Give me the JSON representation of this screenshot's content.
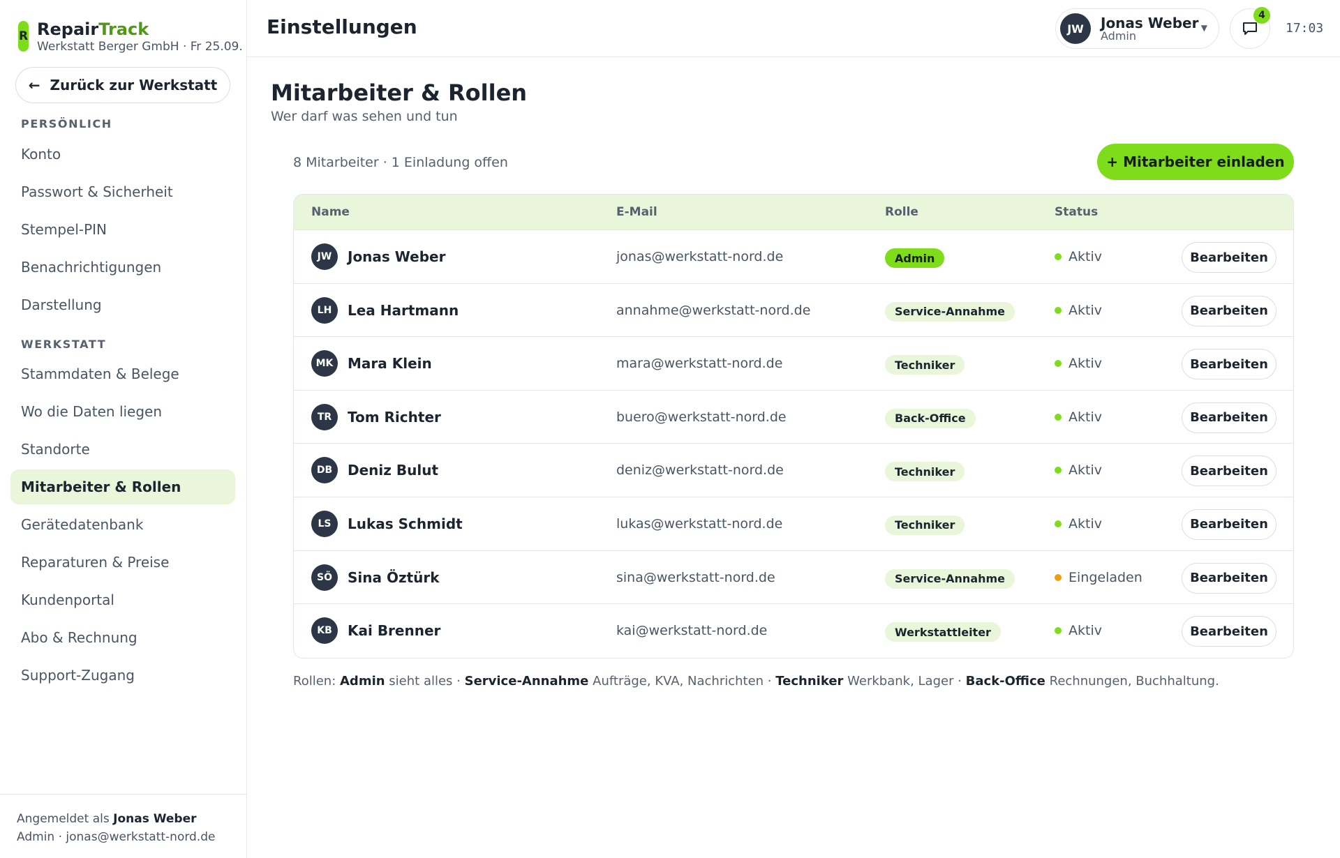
{
  "brand": {
    "logo_letter": "R",
    "name_a": "Repair",
    "name_b": "Track",
    "subtitle": "Werkstatt Berger GmbH · Fr 25.09."
  },
  "sidebar": {
    "back_label": "Zurück zur Werkstatt",
    "section_personal": "PERSÖNLICH",
    "personal_items": [
      "Konto",
      "Passwort & Sicherheit",
      "Stempel-PIN",
      "Benachrichtigungen",
      "Darstellung"
    ],
    "section_workshop": "WERKSTATT",
    "workshop_items": [
      "Stammdaten & Belege",
      "Wo die Daten liegen",
      "Standorte",
      "Mitarbeiter & Rollen",
      "Gerätedatenbank",
      "Reparaturen & Preise",
      "Kundenportal",
      "Abo & Rechnung",
      "Support-Zugang"
    ],
    "active_item": "Mitarbeiter & Rollen",
    "footer_prefix": "Angemeldet als",
    "footer_user": "Jonas Weber",
    "footer_detail": "Admin · jonas@werkstatt-nord.de"
  },
  "header": {
    "title": "Einstellungen",
    "user_initials": "JW",
    "user_name": "Jonas Weber",
    "user_role": "Admin",
    "message_count": "4",
    "time": "17:03"
  },
  "main": {
    "title": "Mitarbeiter & Rollen",
    "subtitle": "Wer darf was sehen und tun",
    "count_text": "8 Mitarbeiter · 1 Einladung offen",
    "invite_label": "+ Mitarbeiter einladen",
    "columns": {
      "name": "Name",
      "email": "E-Mail",
      "role": "Rolle",
      "status": "Status"
    },
    "edit_label": "Bearbeiten",
    "rows": [
      {
        "initials": "JW",
        "name": "Jonas Weber",
        "email": "jonas@werkstatt-nord.de",
        "role": "Admin",
        "role_type": "admin",
        "status": "Aktiv",
        "status_type": "active"
      },
      {
        "initials": "LH",
        "name": "Lea Hartmann",
        "email": "annahme@werkstatt-nord.de",
        "role": "Service-Annahme",
        "role_type": "default",
        "status": "Aktiv",
        "status_type": "active"
      },
      {
        "initials": "MK",
        "name": "Mara Klein",
        "email": "mara@werkstatt-nord.de",
        "role": "Techniker",
        "role_type": "default",
        "status": "Aktiv",
        "status_type": "active"
      },
      {
        "initials": "TR",
        "name": "Tom Richter",
        "email": "buero@werkstatt-nord.de",
        "role": "Back-Office",
        "role_type": "default",
        "status": "Aktiv",
        "status_type": "active"
      },
      {
        "initials": "DB",
        "name": "Deniz Bulut",
        "email": "deniz@werkstatt-nord.de",
        "role": "Techniker",
        "role_type": "default",
        "status": "Aktiv",
        "status_type": "active"
      },
      {
        "initials": "LS",
        "name": "Lukas Schmidt",
        "email": "lukas@werkstatt-nord.de",
        "role": "Techniker",
        "role_type": "default",
        "status": "Aktiv",
        "status_type": "active"
      },
      {
        "initials": "SÖ",
        "name": "Sina Öztürk",
        "email": "sina@werkstatt-nord.de",
        "role": "Service-Annahme",
        "role_type": "default",
        "status": "Eingeladen",
        "status_type": "invited"
      },
      {
        "initials": "KB",
        "name": "Kai Brenner",
        "email": "kai@werkstatt-nord.de",
        "role": "Werkstattleiter",
        "role_type": "default",
        "status": "Aktiv",
        "status_type": "active"
      }
    ],
    "legend": {
      "prefix": "Rollen:",
      "r1": "Admin",
      "d1": "sieht alles ·",
      "r2": "Service-Annahme",
      "d2": "Aufträge, KVA, Nachrichten ·",
      "r3": "Techniker",
      "d3": "Werkbank, Lager ·",
      "r4": "Back-Office",
      "d4": "Rechnungen, Buchhaltung."
    }
  },
  "colors": {
    "accent": "#7fdc1a",
    "accent_soft": "#e9f6d9",
    "invited": "#f39c12",
    "avatar": "#2c3646"
  }
}
